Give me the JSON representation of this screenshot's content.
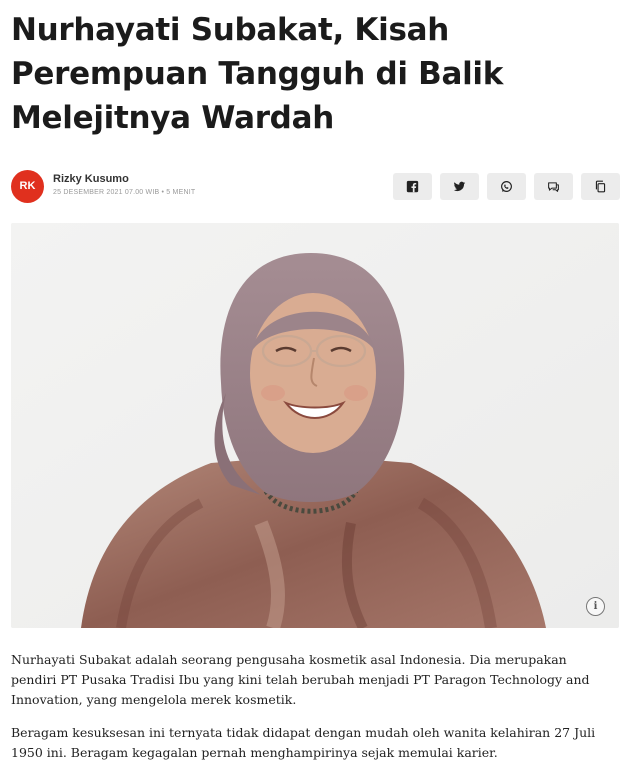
{
  "article": {
    "title": "Nurhayati Subakat, Kisah Perempuan Tangguh di Balik Melejitnya Wardah",
    "author_initials": "RK",
    "author_name": "Rizky Kusumo",
    "date_line": "25 DESEMBER 2021 07.00 WIB • 5 MENIT",
    "paragraphs": [
      "Nurhayati Subakat adalah seorang pengusaha kosmetik asal Indonesia. Dia merupakan pendiri PT Pusaka Tradisi Ibu yang kini telah berubah menjadi PT Paragon Technology and Innovation, yang mengelola merek kosmetik.",
      "Beragam kesuksesan ini ternyata tidak didapat dengan mudah oleh wanita kelahiran 27 Juli 1950 ini. Beragam kegagalan pernah menghampirinya sejak memulai karier."
    ],
    "info_glyph": "i"
  },
  "share_icons": [
    "facebook-icon",
    "twitter-icon",
    "whatsapp-icon",
    "comment-icon",
    "copy-icon"
  ],
  "colors": {
    "avatar": "#e0301e",
    "button_bg": "#ececec",
    "title": "#1b1b1b"
  }
}
